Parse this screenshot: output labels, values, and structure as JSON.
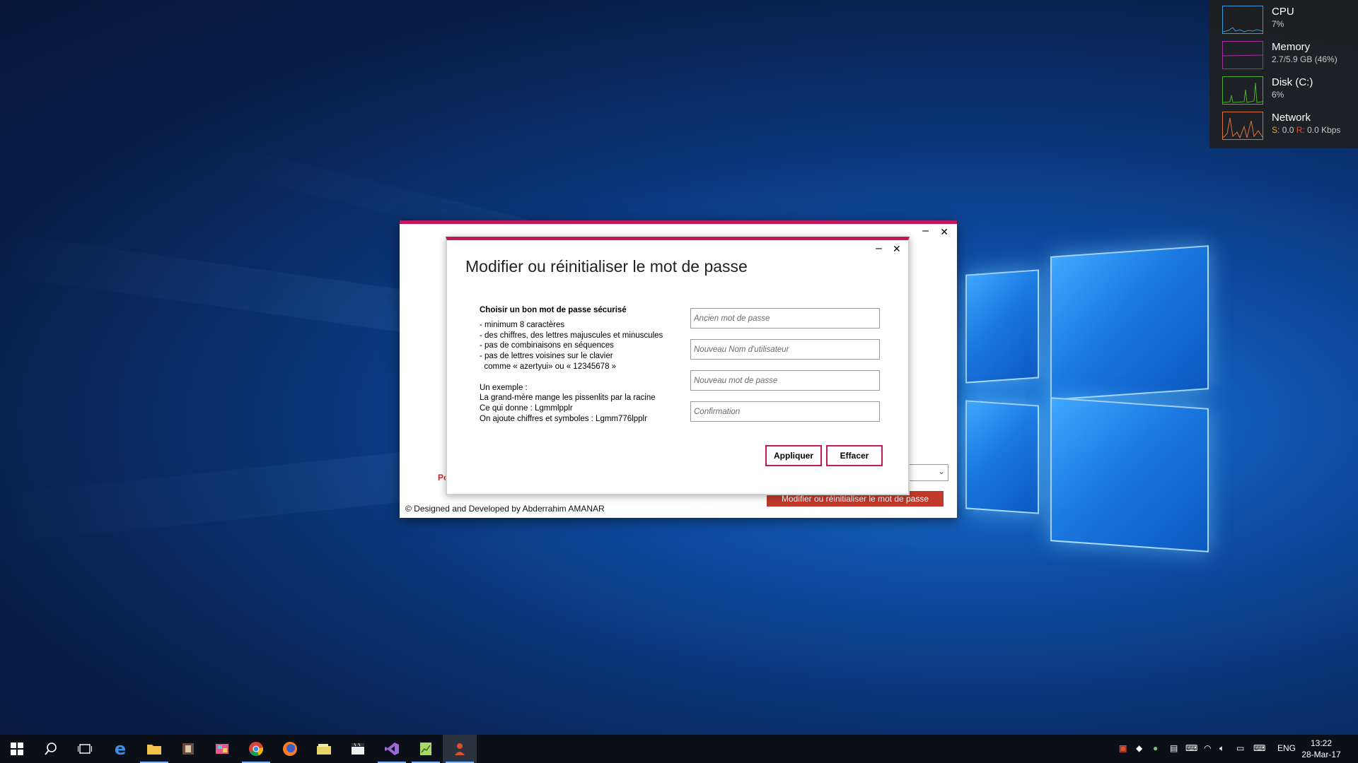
{
  "monitor": {
    "cpu": {
      "title": "CPU",
      "value": "7%",
      "color": "#3a9bd8"
    },
    "memory": {
      "title": "Memory",
      "value": "2.7/5.9 GB (46%)",
      "color": "#a02fa0"
    },
    "disk": {
      "title": "Disk (C:)",
      "value": "6%",
      "color": "#4caf30"
    },
    "network": {
      "title": "Network",
      "send_label": "S:",
      "send_value": "0.0",
      "recv_label": "R:",
      "recv_value": "0.0 Kbps",
      "color": "#e0703a"
    }
  },
  "back_window": {
    "footer": "© Designed and Developed by Abderrahim AMANAR",
    "partial_label": "Po",
    "button_label": "Modifier ou réinitialiser le mot de passe"
  },
  "dialog": {
    "title": "Modifier ou réinitialiser le mot de passe",
    "minimize": "–",
    "close": "✕",
    "guide_heading": "Choisir un bon mot de passe sécurisé",
    "guide_lines": [
      "- minimum 8 caractères",
      "- des chiffres, des lettres majuscules et minuscules",
      "- pas de combinaisons en séquences",
      "- pas de lettres voisines sur le clavier",
      "  comme « azertyui» ou « 12345678 »",
      "",
      "Un exemple :",
      "La grand-mère mange les pissenlits par la racine",
      "Ce qui donne : Lgmmlpplr",
      "On ajoute chiffres et symboles : Lgmm776lpplr"
    ],
    "fields": {
      "old_password": "Ancien mot de passe",
      "new_username": "Nouveau Nom d'utilisateur",
      "new_password": "Nouveau mot de passe",
      "confirmation": "Confirmation"
    },
    "apply_label": "Appliquer",
    "clear_label": "Effacer"
  },
  "taskbar": {
    "lang": "ENG",
    "time": "13:22",
    "date": "28-Mar-17"
  }
}
